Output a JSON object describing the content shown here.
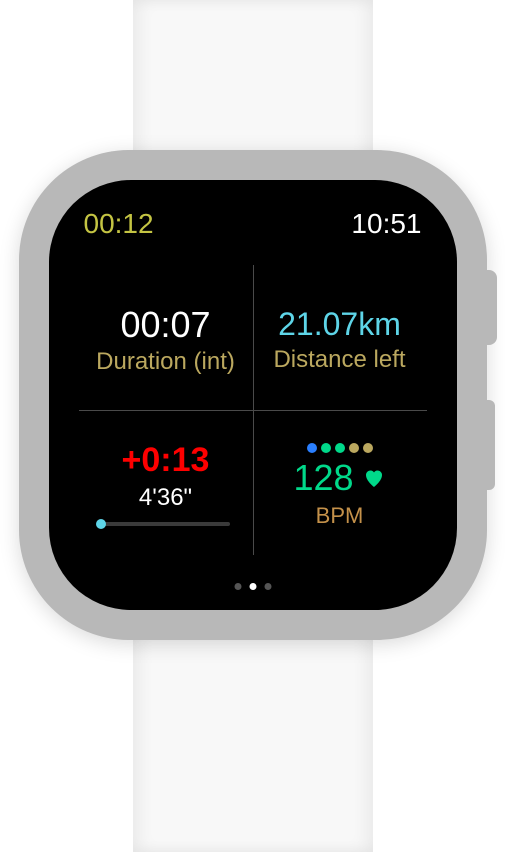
{
  "header": {
    "elapsed": "00:12",
    "clock": "10:51"
  },
  "duration": {
    "value": "00:07",
    "label": "Duration (int)"
  },
  "distance": {
    "value": "21.07km",
    "label": "Distance left"
  },
  "pace": {
    "diff": "+0:13",
    "target": "4'36\"",
    "progress_pct": 2
  },
  "heart": {
    "bpm": "128",
    "label": "BPM",
    "zone_colors": [
      "#2a7fff",
      "#00d98a",
      "#00d98a",
      "#bba85f",
      "#bba85f"
    ],
    "heart_color": "#00d98a"
  },
  "pagination": {
    "count": 3,
    "active_index": 1
  }
}
